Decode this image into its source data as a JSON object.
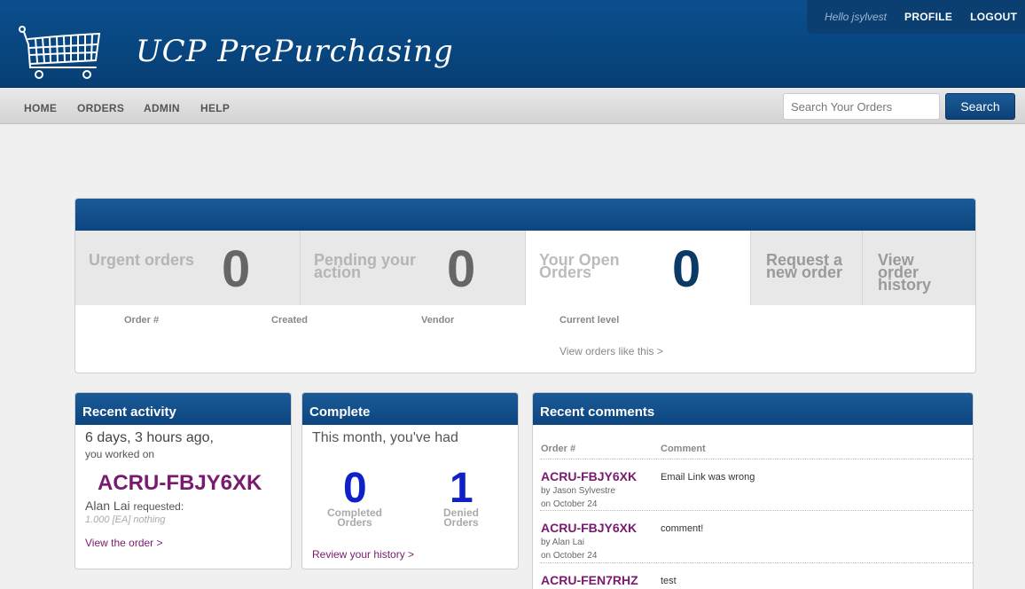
{
  "header": {
    "app_title": "UCP PrePurchasing",
    "greeting": "Hello jsylvest",
    "profile_link": "PROFILE",
    "logout_link": "LOGOUT"
  },
  "nav": {
    "items": [
      "HOME",
      "ORDERS",
      "ADMIN",
      "HELP"
    ],
    "search_placeholder": "Search Your Orders",
    "search_button": "Search"
  },
  "dashboard": {
    "tabs": [
      {
        "label": "Urgent orders",
        "count": "0"
      },
      {
        "label": "Pending your action",
        "count": "0"
      },
      {
        "label": "Your Open Orders",
        "count": "0"
      },
      {
        "label": "Request a new order"
      },
      {
        "label": "View order history"
      }
    ],
    "columns": [
      "Order #",
      "Created",
      "Vendor",
      "Current level"
    ],
    "view_link": "View orders like this >"
  },
  "recent_activity": {
    "title": "Recent activity",
    "time_ago": "6 days, 3 hours ago,",
    "worked_on": "you worked on",
    "order_id": "ACRU-FBJY6XK",
    "requester": "Alan Lai",
    "requested_word": "requested:",
    "item": "1.000 [EA] nothing",
    "view_link": "View the order >"
  },
  "complete": {
    "title": "Complete",
    "intro": "This month, you've had",
    "completed_count": "0",
    "completed_label_1": "Completed",
    "completed_label_2": "Orders",
    "denied_count": "1",
    "denied_label_1": "Denied",
    "denied_label_2": "Orders",
    "history_link": "Review your history >"
  },
  "recent_comments": {
    "title": "Recent comments",
    "col_order": "Order #",
    "col_comment": "Comment",
    "rows": [
      {
        "order": "ACRU-FBJY6XK",
        "by": "by Jason Sylvestre",
        "on": "on October 24",
        "comment": "Email Link was wrong"
      },
      {
        "order": "ACRU-FBJY6XK",
        "by": "by Alan Lai",
        "on": "on October 24",
        "comment": "comment!"
      },
      {
        "order": "ACRU-FEN7RHZ",
        "by": "",
        "on": "",
        "comment": "test"
      }
    ]
  },
  "colors": {
    "brand_blue": "#0a4f8e",
    "link_purple": "#7a1a6e",
    "count_blue": "#1020c8"
  }
}
